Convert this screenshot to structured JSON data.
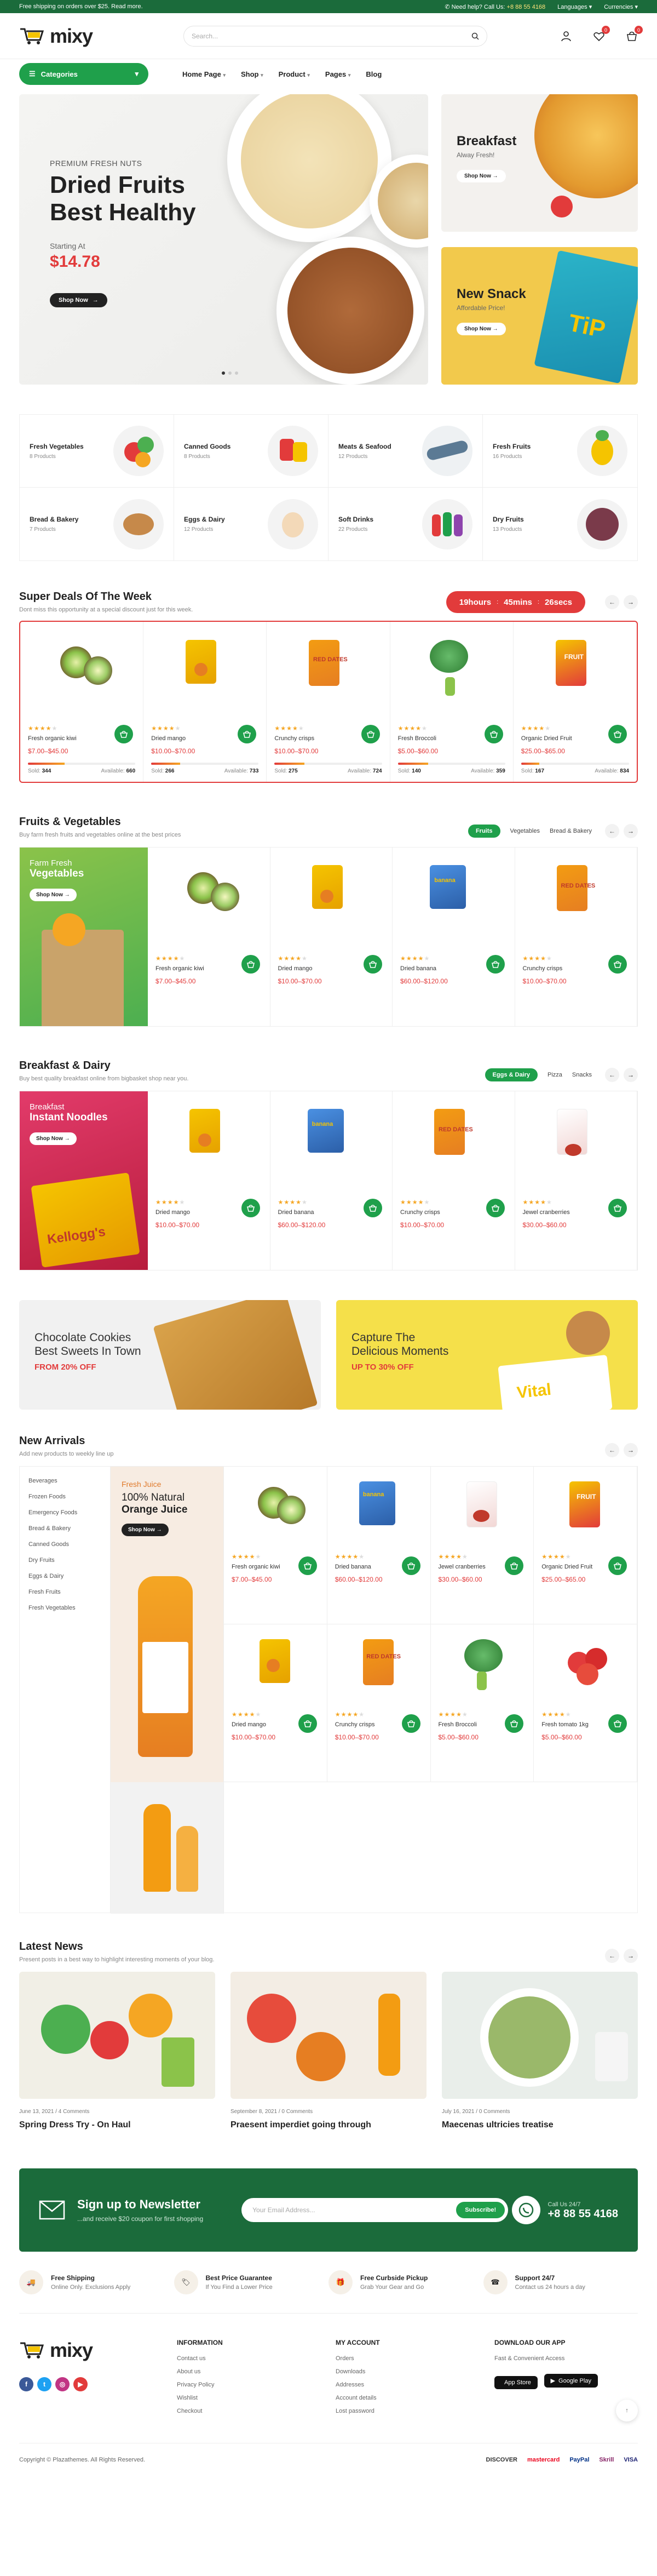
{
  "topbar": {
    "promo": "Free shipping on orders over $25. Read more.",
    "help_label": "Need help? Call Us:",
    "phone": "+8 88 55 4168",
    "languages": "Languages",
    "currencies": "Currencies"
  },
  "header": {
    "logo": "mixy",
    "search_placeholder": "Search...",
    "wishlist_count": "0",
    "cart_count": "0"
  },
  "nav": {
    "categories": "Categories",
    "items": [
      "Home Page",
      "Shop",
      "Product",
      "Pages",
      "Blog"
    ]
  },
  "hero": {
    "pre": "PREMIUM FRESH NUTS",
    "title1": "Dried Fruits",
    "title2": "Best Healthy",
    "starting": "Starting At",
    "price": "$14.78",
    "shop": "Shop Now"
  },
  "side_banners": [
    {
      "title": "Breakfast",
      "sub": "Alway Fresh!",
      "shop": "Shop Now"
    },
    {
      "title": "New Snack",
      "sub": "Affordable Price!",
      "shop": "Shop Now"
    }
  ],
  "categories": [
    {
      "name": "Fresh Vegetables",
      "count": "8 Products"
    },
    {
      "name": "Canned Goods",
      "count": "8 Products"
    },
    {
      "name": "Meats & Seafood",
      "count": "12 Products"
    },
    {
      "name": "Fresh Fruits",
      "count": "16 Products"
    },
    {
      "name": "Bread & Bakery",
      "count": "7 Products"
    },
    {
      "name": "Eggs & Dairy",
      "count": "12 Products"
    },
    {
      "name": "Soft Drinks",
      "count": "22 Products"
    },
    {
      "name": "Dry Fruits",
      "count": "13 Products"
    }
  ],
  "deals": {
    "title": "Super Deals Of The Week",
    "sub": "Dont miss this opportunity at a special discount just for this week.",
    "timer": {
      "hours": "19hours",
      "mins": "45mins",
      "secs": "26secs"
    },
    "products": [
      {
        "name": "Fresh organic kiwi",
        "price": "$7.00–$45.00",
        "sold": "344",
        "available": "660",
        "progress": 0.34
      },
      {
        "name": "Dried mango",
        "price": "$10.00–$70.00",
        "sold": "266",
        "available": "733",
        "progress": 0.27
      },
      {
        "name": "Crunchy crisps",
        "price": "$10.00–$70.00",
        "sold": "275",
        "available": "724",
        "progress": 0.28
      },
      {
        "name": "Fresh Broccoli",
        "price": "$5.00–$60.00",
        "sold": "140",
        "available": "359",
        "progress": 0.28
      },
      {
        "name": "Organic Dried Fruit",
        "price": "$25.00–$65.00",
        "sold": "167",
        "available": "834",
        "progress": 0.17
      }
    ],
    "sold_label": "Sold:",
    "available_label": "Available:"
  },
  "fruits": {
    "title": "Fruits & Vegetables",
    "sub": "Buy farm fresh fruits and vegetables online at the best prices",
    "tabs": [
      "Fruits",
      "Vegetables",
      "Bread & Bakery"
    ],
    "promo": {
      "t1": "Farm Fresh",
      "t2": "Vegetables",
      "shop": "Shop Now"
    },
    "products": [
      {
        "name": "Fresh organic kiwi",
        "price": "$7.00–$45.00"
      },
      {
        "name": "Dried mango",
        "price": "$10.00–$70.00"
      },
      {
        "name": "Dried banana",
        "price": "$60.00–$120.00"
      },
      {
        "name": "Crunchy crisps",
        "price": "$10.00–$70.00"
      }
    ]
  },
  "breakfast": {
    "title": "Breakfast & Dairy",
    "sub": "Buy best quality breakfast online from bigbasket shop near you.",
    "tabs": [
      "Eggs & Dairy",
      "Pizza",
      "Snacks"
    ],
    "promo": {
      "t1": "Breakfast",
      "t2": "Instant Noodles",
      "shop": "Shop Now"
    },
    "products": [
      {
        "name": "Dried mango",
        "price": "$10.00–$70.00"
      },
      {
        "name": "Dried banana",
        "price": "$60.00–$120.00"
      },
      {
        "name": "Crunchy crisps",
        "price": "$10.00–$70.00"
      },
      {
        "name": "Jewel cranberries",
        "price": "$30.00–$60.00"
      }
    ]
  },
  "banners": [
    {
      "t1": "Chocolate Cookies",
      "t2": "Best Sweets In Town",
      "s": "FROM 20% OFF"
    },
    {
      "t1": "Capture The",
      "t2": "Delicious Moments",
      "s": "UP TO 30% OFF"
    }
  ],
  "new_arrivals": {
    "title": "New Arrivals",
    "sub": "Add new products to weekly line up",
    "categories": [
      "Beverages",
      "Frozen Foods",
      "Emergency Foods",
      "Bread & Bakery",
      "Canned Goods",
      "Dry Fruits",
      "Eggs & Dairy",
      "Fresh Fruits",
      "Fresh Vegetables"
    ],
    "promo": {
      "t1": "Fresh Juice",
      "t2": "100% Natural",
      "t3": "Orange Juice",
      "shop": "Shop Now"
    },
    "products": [
      {
        "name": "Fresh organic kiwi",
        "price": "$7.00–$45.00"
      },
      {
        "name": "Dried banana",
        "price": "$60.00–$120.00"
      },
      {
        "name": "Jewel cranberries",
        "price": "$30.00–$60.00"
      },
      {
        "name": "Organic Dried Fruit",
        "price": "$25.00–$65.00"
      },
      {
        "name": "Dried mango",
        "price": "$10.00–$70.00"
      },
      {
        "name": "Crunchy crisps",
        "price": "$10.00–$70.00"
      },
      {
        "name": "Fresh Broccoli",
        "price": "$5.00–$60.00"
      },
      {
        "name": "Fresh tomato 1kg",
        "price": "$5.00–$60.00"
      }
    ]
  },
  "news": {
    "title": "Latest News",
    "sub": "Present posts in a best way to highlight interesting moments of your blog.",
    "posts": [
      {
        "meta": "June 13, 2021 / 4 Comments",
        "title": "Spring Dress Try - On Haul"
      },
      {
        "meta": "September 8, 2021 / 0 Comments",
        "title": "Praesent imperdiet going through"
      },
      {
        "meta": "July 16, 2021 / 0 Comments",
        "title": "Maecenas ultricies treatise"
      }
    ]
  },
  "newsletter": {
    "title": "Sign up to Newsletter",
    "sub": "...and receive $20 coupon for first shopping",
    "placeholder": "Your Email Address...",
    "button": "Subscribe!",
    "call_label": "Call Us 24/7",
    "phone": "+8 88 55 4168"
  },
  "features": [
    {
      "title": "Free Shipping",
      "sub": "Online Only. Exclusions Apply"
    },
    {
      "title": "Best Price Guarantee",
      "sub": "If You Find a Lower Price"
    },
    {
      "title": "Free Curbside Pickup",
      "sub": "Grab Your Gear and Go"
    },
    {
      "title": "Support 24/7",
      "sub": "Contact us 24 hours a day"
    }
  ],
  "footer": {
    "info_title": "INFORMATION",
    "info": [
      "Contact us",
      "About us",
      "Privacy Policy",
      "Wishlist",
      "Checkout"
    ],
    "account_title": "MY ACCOUNT",
    "account": [
      "Orders",
      "Downloads",
      "Addresses",
      "Account details",
      "Lost password"
    ],
    "app_title": "DOWNLOAD OUR APP",
    "app_sub": "Fast & Convenient Access",
    "app_store": "App Store",
    "google_play": "Google Play",
    "copyright": "Copyright © Plazathemes. All Rights Reserved.",
    "payments": [
      "DISCOVER",
      "mastercard",
      "PayPal",
      "Skrill",
      "VISA"
    ]
  },
  "ui": {
    "rating_stars": 4,
    "accent": "#1fa04b",
    "sale_red": "#e23b3b",
    "topbar_green": "#1b6b3b"
  }
}
